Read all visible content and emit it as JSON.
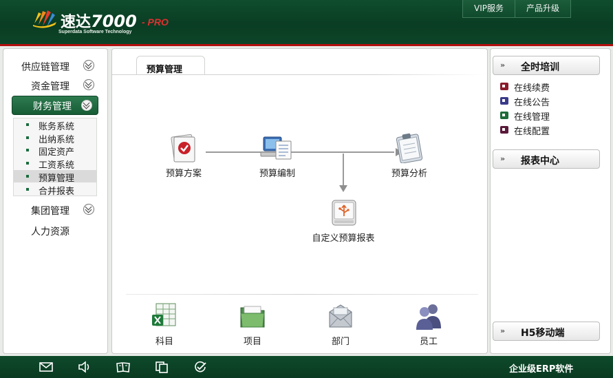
{
  "header": {
    "logo_name": "速达",
    "logo_number": "7000",
    "logo_suffix": "- PRO",
    "logo_tagline": "Superdata Software Technology",
    "links": [
      {
        "label": "VIP服务"
      },
      {
        "label": "产品升级"
      }
    ]
  },
  "left_menu": {
    "items": [
      {
        "label": "供应链管理",
        "expandable": true
      },
      {
        "label": "资金管理",
        "expandable": true
      },
      {
        "label": "财务管理",
        "expandable": true,
        "active": true
      },
      {
        "label": "集团管理",
        "expandable": true
      },
      {
        "label": "人力资源",
        "expandable": false
      }
    ],
    "submenu": [
      {
        "label": "账务系统"
      },
      {
        "label": "出纳系统"
      },
      {
        "label": "固定资产"
      },
      {
        "label": "工资系统"
      },
      {
        "label": "预算管理",
        "selected": true
      },
      {
        "label": "合并报表"
      }
    ]
  },
  "center": {
    "tab_label": "预算管理",
    "flow_nodes": [
      {
        "label": "预算方案",
        "icon": "checkmark-document-icon"
      },
      {
        "label": "预算编制",
        "icon": "computer-document-icon"
      },
      {
        "label": "预算分析",
        "icon": "clipboard-icon"
      },
      {
        "label": "自定义预算报表",
        "icon": "usb-drive-icon"
      }
    ],
    "shortcuts": [
      {
        "label": "科目",
        "icon": "spreadsheet-icon"
      },
      {
        "label": "项目",
        "icon": "folder-icon"
      },
      {
        "label": "部门",
        "icon": "envelope-icon"
      },
      {
        "label": "员工",
        "icon": "users-icon"
      }
    ]
  },
  "right_panel": {
    "training_title": "全时培训",
    "training_links": [
      {
        "label": "在线续费",
        "color": "#8a1a2a"
      },
      {
        "label": "在线公告",
        "color": "#3a3a8a"
      },
      {
        "label": "在线管理",
        "color": "#1d6a3a"
      },
      {
        "label": "在线配置",
        "color": "#5a1a3a"
      }
    ],
    "report_title": "报表中心",
    "mobile_title": "H5移动端",
    "arrow_glyph": "»"
  },
  "footer": {
    "icons": [
      "mail-icon",
      "speaker-icon",
      "book-icon",
      "copy-icon",
      "check-circle-icon"
    ],
    "text": "企业级ERP软件"
  },
  "colors": {
    "header_green": "#0a3d23",
    "accent_red": "#b40e0e",
    "menu_active_green": "#1f6b41"
  }
}
